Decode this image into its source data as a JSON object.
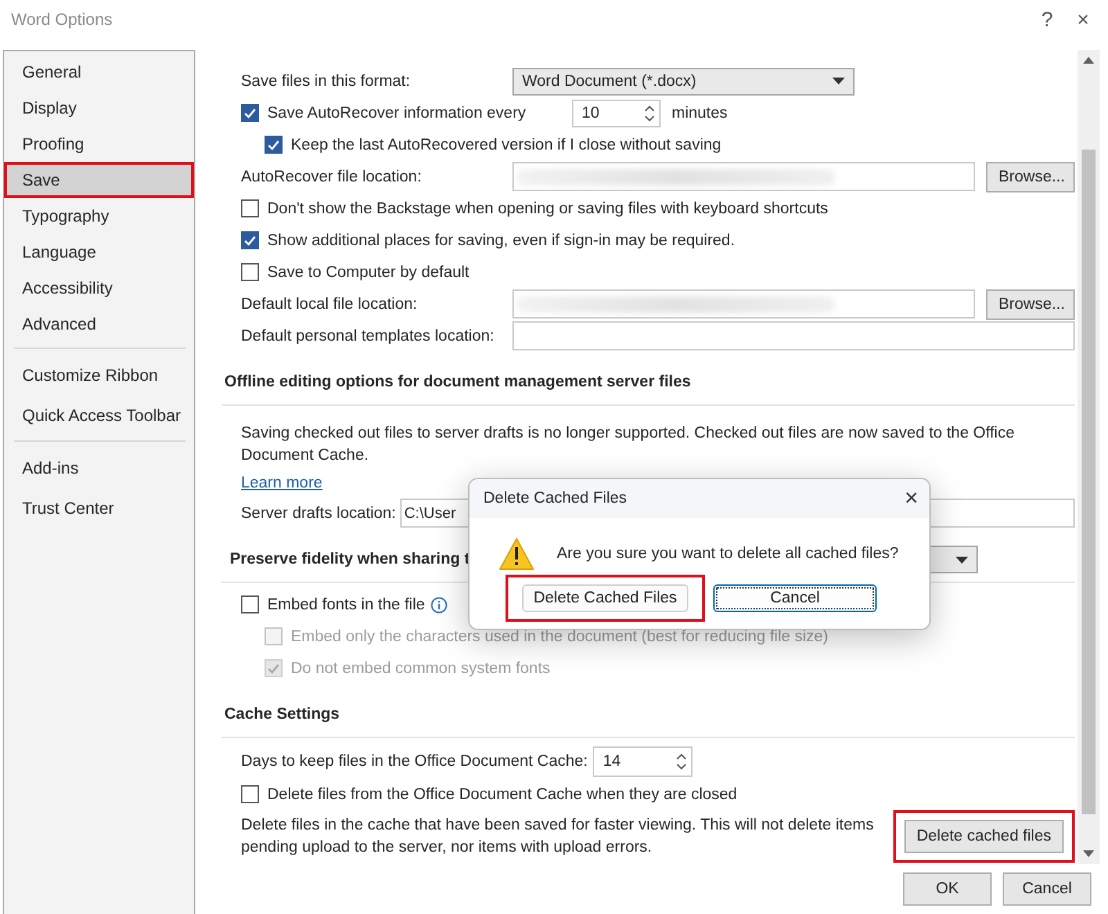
{
  "window": {
    "title": "Word Options",
    "help": "?",
    "close": "×"
  },
  "sidebar": {
    "groups": [
      [
        {
          "label": "General",
          "selected": false,
          "highlighted": false
        },
        {
          "label": "Display",
          "selected": false,
          "highlighted": false
        },
        {
          "label": "Proofing",
          "selected": false,
          "highlighted": false
        },
        {
          "label": "Save",
          "selected": true,
          "highlighted": true
        },
        {
          "label": "Typography",
          "selected": false,
          "highlighted": false
        },
        {
          "label": "Language",
          "selected": false,
          "highlighted": false
        },
        {
          "label": "Accessibility",
          "selected": false,
          "highlighted": false
        },
        {
          "label": "Advanced",
          "selected": false,
          "highlighted": false
        }
      ],
      [
        {
          "label": "Customize Ribbon",
          "selected": false,
          "highlighted": false
        },
        {
          "label": "Quick Access Toolbar",
          "selected": false,
          "highlighted": false
        }
      ],
      [
        {
          "label": "Add-ins",
          "selected": false,
          "highlighted": false
        },
        {
          "label": "Trust Center",
          "selected": false,
          "highlighted": false
        }
      ]
    ]
  },
  "sections": [
    {
      "rows": [
        {
          "kind": "select",
          "label": "Save files in this format:",
          "value": "Word Document (*.docx)"
        },
        {
          "kind": "checkbox_spin",
          "label": "Save AutoRecover information every",
          "checked": true,
          "disabled": false,
          "value": "10",
          "unit": "minutes",
          "children": [
            {
              "kind": "checkbox",
              "label": "Keep the last AutoRecovered version if I close without saving",
              "checked": true,
              "disabled": false
            }
          ]
        },
        {
          "kind": "path",
          "label": "AutoRecover file location:",
          "redacted": true,
          "button": "Browse..."
        },
        {
          "kind": "checkbox",
          "label": "Don't show the Backstage when opening or saving files with keyboard shortcuts",
          "checked": false,
          "disabled": false
        },
        {
          "kind": "checkbox",
          "label": "Show additional places for saving, even if sign-in may be required.",
          "checked": true,
          "disabled": false
        },
        {
          "kind": "checkbox",
          "label": "Save to Computer by default",
          "checked": false,
          "disabled": false
        },
        {
          "kind": "path",
          "label": "Default local file location:",
          "redacted": true,
          "button": "Browse..."
        },
        {
          "kind": "path",
          "label": "Default personal templates location:",
          "redacted": false
        }
      ]
    },
    {
      "heading": "Offline editing options for document management server files",
      "rows": [
        {
          "kind": "text",
          "text": "Saving checked out files to server drafts is no longer supported. Checked out files are now saved to the Office Document Cache."
        },
        {
          "kind": "link",
          "text": "Learn more"
        },
        {
          "kind": "path",
          "label": "Server drafts location:",
          "value": "C:\\User"
        }
      ]
    },
    {
      "heading": "Preserve fidelity when sharing t",
      "dropdown": true,
      "rows": [
        {
          "kind": "checkbox",
          "label": "Embed fonts in the file",
          "checked": false,
          "disabled": false,
          "info": true,
          "children": [
            {
              "kind": "checkbox",
              "label": "Embed only the characters used in the document (best for reducing file size)",
              "checked": false,
              "disabled": true
            },
            {
              "kind": "checkbox",
              "label": "Do not embed common system fonts",
              "checked": true,
              "disabled": true
            }
          ]
        }
      ]
    },
    {
      "heading": "Cache Settings",
      "rows": [
        {
          "kind": "spin",
          "label": "Days to keep files in the Office Document Cache:",
          "value": "14"
        },
        {
          "kind": "checkbox",
          "label": "Delete files from the Office Document Cache when they are closed",
          "checked": false,
          "disabled": false
        },
        {
          "kind": "text_button",
          "text": "Delete files in the cache that have been saved for faster viewing. This will not delete items pending upload to the server, nor items with upload errors.",
          "button": "Delete cached files",
          "highlighted": true
        }
      ]
    }
  ],
  "footer": {
    "buttons": [
      {
        "label": "OK"
      },
      {
        "label": "Cancel"
      }
    ]
  },
  "dialog": {
    "title": "Delete Cached Files",
    "close": "×",
    "message": "Are you sure you want to delete all cached files?",
    "buttons": [
      {
        "label": "Delete Cached Files",
        "highlighted": true,
        "focused": false
      },
      {
        "label": "Cancel",
        "highlighted": false,
        "focused": true
      }
    ]
  }
}
